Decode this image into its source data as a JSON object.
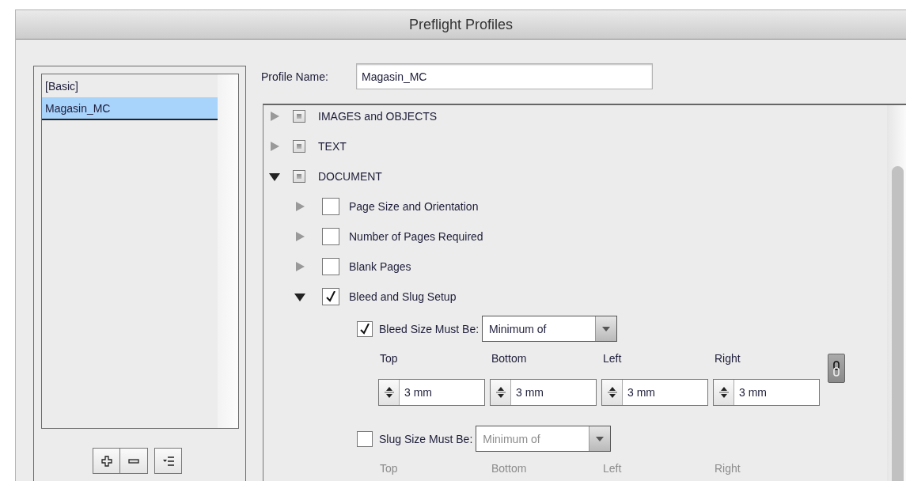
{
  "window": {
    "title": "Preflight Profiles"
  },
  "profiles": {
    "items": [
      {
        "label": "[Basic]",
        "selected": false
      },
      {
        "label": "Magasin_MC",
        "selected": true
      }
    ],
    "buttons": [
      {
        "kind": "add"
      },
      {
        "kind": "remove"
      },
      {
        "kind": "menu"
      }
    ]
  },
  "profile_name": {
    "label": "Profile Name:",
    "value": "Magasin_MC"
  },
  "tree": [
    {
      "label": "IMAGES and OBJECTS",
      "expanded": false,
      "checked": false,
      "mixed": true
    },
    {
      "label": "TEXT",
      "expanded": false,
      "checked": false,
      "mixed": true
    },
    {
      "label": "DOCUMENT",
      "expanded": true,
      "checked": false,
      "mixed": true,
      "children": [
        {
          "label": "Page Size and Orientation",
          "expanded": false,
          "checked": false
        },
        {
          "label": "Number of Pages Required",
          "expanded": false,
          "checked": false
        },
        {
          "label": "Blank Pages",
          "expanded": false,
          "checked": false
        },
        {
          "label": "Bleed and Slug Setup",
          "expanded": true,
          "checked": true,
          "settings": [
            {
              "label": "Bleed Size Must Be:",
              "checked": true,
              "disabled": false,
              "dropdown": "Minimum of",
              "columns": [
                "Top",
                "Bottom",
                "Left",
                "Right"
              ],
              "values": [
                "3 mm",
                "3 mm",
                "3 mm",
                "3 mm"
              ],
              "linked": true
            },
            {
              "label": "Slug Size Must Be:",
              "checked": false,
              "disabled": true,
              "dropdown": "Minimum of",
              "columns": [
                "Top",
                "Bottom",
                "Left",
                "Right"
              ]
            }
          ]
        }
      ]
    }
  ]
}
